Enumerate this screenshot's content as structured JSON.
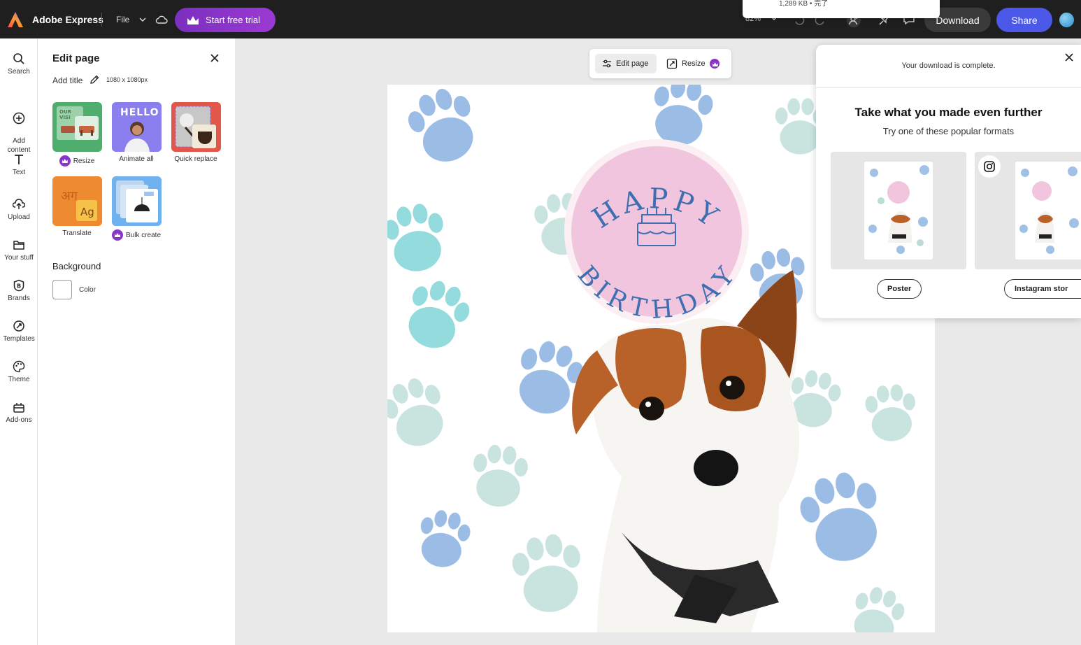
{
  "topbar": {
    "app_name": "Adobe Express",
    "file_label": "File",
    "trial_label": "Start free trial",
    "zoom_label": "82%",
    "download_label": "Download",
    "share_label": "Share",
    "toast_text": "1,289 KB • 完了"
  },
  "rail": {
    "items": [
      {
        "label": "Search",
        "icon": "search-icon"
      },
      {
        "label": "Add\ncontent",
        "icon": "plus-circle-icon"
      },
      {
        "label": "Text",
        "icon": "text-icon"
      },
      {
        "label": "Upload",
        "icon": "upload-icon"
      },
      {
        "label": "Your stuff",
        "icon": "folder-icon"
      },
      {
        "label": "Brands",
        "icon": "brand-icon"
      },
      {
        "label": "Templates",
        "icon": "templates-icon"
      },
      {
        "label": "Theme",
        "icon": "palette-icon"
      },
      {
        "label": "Add-ons",
        "icon": "addons-icon"
      }
    ]
  },
  "panel": {
    "title": "Edit page",
    "add_title": "Add title",
    "dimensions": "1080 x 1080px",
    "tiles": [
      {
        "label": "Resize",
        "premium": true
      },
      {
        "label": "Animate all",
        "premium": false
      },
      {
        "label": "Quick replace",
        "premium": false
      },
      {
        "label": "Translate",
        "premium": false
      },
      {
        "label": "Bulk create",
        "premium": true
      }
    ],
    "background_title": "Background",
    "color_label": "Color"
  },
  "canvas_toolbar": {
    "edit_page": "Edit page",
    "resize": "Resize"
  },
  "design": {
    "top_text": "HAPPY",
    "bottom_text": "BIRTHDAY"
  },
  "popup": {
    "message": "Your download is complete.",
    "heading": "Take what you made even further",
    "subheading": "Try one of these popular formats",
    "formats": [
      {
        "label": "Poster"
      },
      {
        "label": "Instagram stor"
      }
    ]
  },
  "colors": {
    "accent_purple": "#8a34c9",
    "share_blue": "#4b58e8",
    "topbar": "#1f1f1f",
    "badge_pink": "#f2c5df",
    "paw_blue": "#6f9fd8",
    "paw_teal": "#7fd3d6"
  }
}
